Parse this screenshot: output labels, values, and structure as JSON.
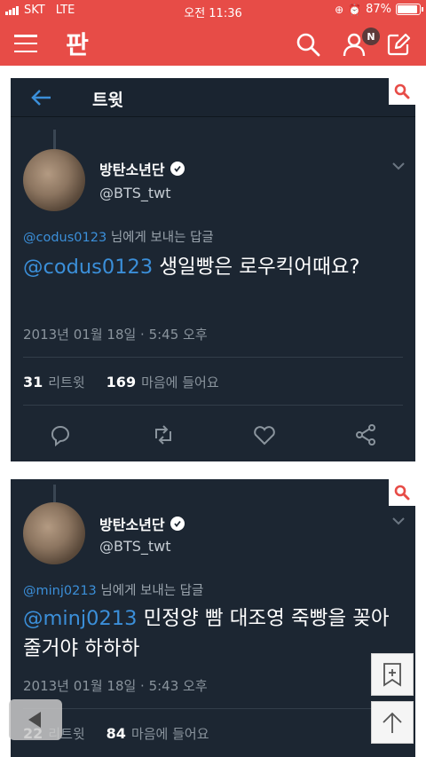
{
  "status_bar": {
    "carrier": "SKT",
    "network": "LTE",
    "time": "오전 11:36",
    "battery": "87%"
  },
  "app_bar": {
    "logo": "판",
    "notification_badge": "N",
    "icons": [
      "menu-icon",
      "search-icon",
      "user-icon",
      "edit-icon"
    ],
    "accent_color": "#e74c47"
  },
  "tweet1": {
    "header_title": "트윗",
    "author_name": "방탄소년단",
    "author_handle": "@BTS_twt",
    "reply_mention": "@codus0123",
    "reply_suffix": "님에게 보내는 답글",
    "text_mention": "@codus0123",
    "text_rest": " 생일빵은 로우킥어때요?",
    "timestamp": "2013년 01월 18일 · 5:45 오후",
    "retweet_count": "31",
    "retweet_label": "리트윗",
    "like_count": "169",
    "like_label": "마음에 들어요"
  },
  "tweet2": {
    "author_name": "방탄소년단",
    "author_handle": "@BTS_twt",
    "reply_mention": "@minj0213",
    "reply_suffix": "님에게 보내는 답글",
    "text_mention": "@minj0213",
    "text_rest": " 민정양 빰 대조영 죽빵을 꽂아줄거야 하하하",
    "timestamp": "2013년 01월 18일 · 5:43 오후",
    "retweet_count": "22",
    "retweet_label": "리트윗",
    "like_count": "84",
    "like_label": "마음에 들어요"
  }
}
